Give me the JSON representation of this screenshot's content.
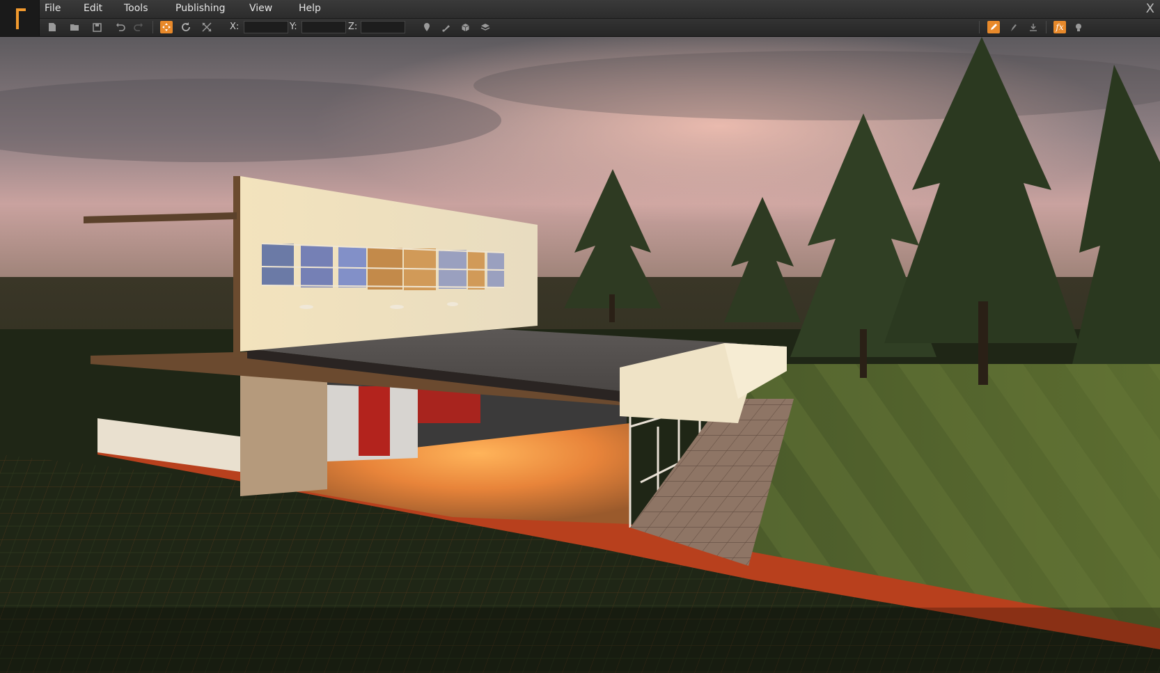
{
  "menu": {
    "file": "File",
    "edit": "Edit",
    "tools": "Tools",
    "publishing": "Publishing",
    "view": "View",
    "help": "Help"
  },
  "window": {
    "close_glyph": "X"
  },
  "toolbar": {
    "icons": [
      "new-file-icon",
      "open-folder-icon",
      "save-icon",
      "undo-icon",
      "redo-icon",
      "move-tool-icon",
      "rotate-tool-icon",
      "scale-tool-icon",
      "place-marker-icon",
      "brush-icon",
      "cube-icon",
      "layers-icon",
      "edit-pencil-icon",
      "paint-icon",
      "download-icon",
      "fx-icon",
      "light-bulb-icon"
    ],
    "x_label": "X:",
    "y_label": "Y:",
    "z_label": "Z:",
    "x_value": "",
    "y_value": "",
    "z_value": "",
    "fx_label": "fx"
  },
  "colors": {
    "accent": "#e8892a",
    "menubar": "#2f2f2f",
    "sky_top": "#5e5a5f",
    "sky_glow": "#d9a9a6",
    "grass": "#596a2f",
    "ground_grid": "#1d2614",
    "foundation": "#c0421c"
  }
}
